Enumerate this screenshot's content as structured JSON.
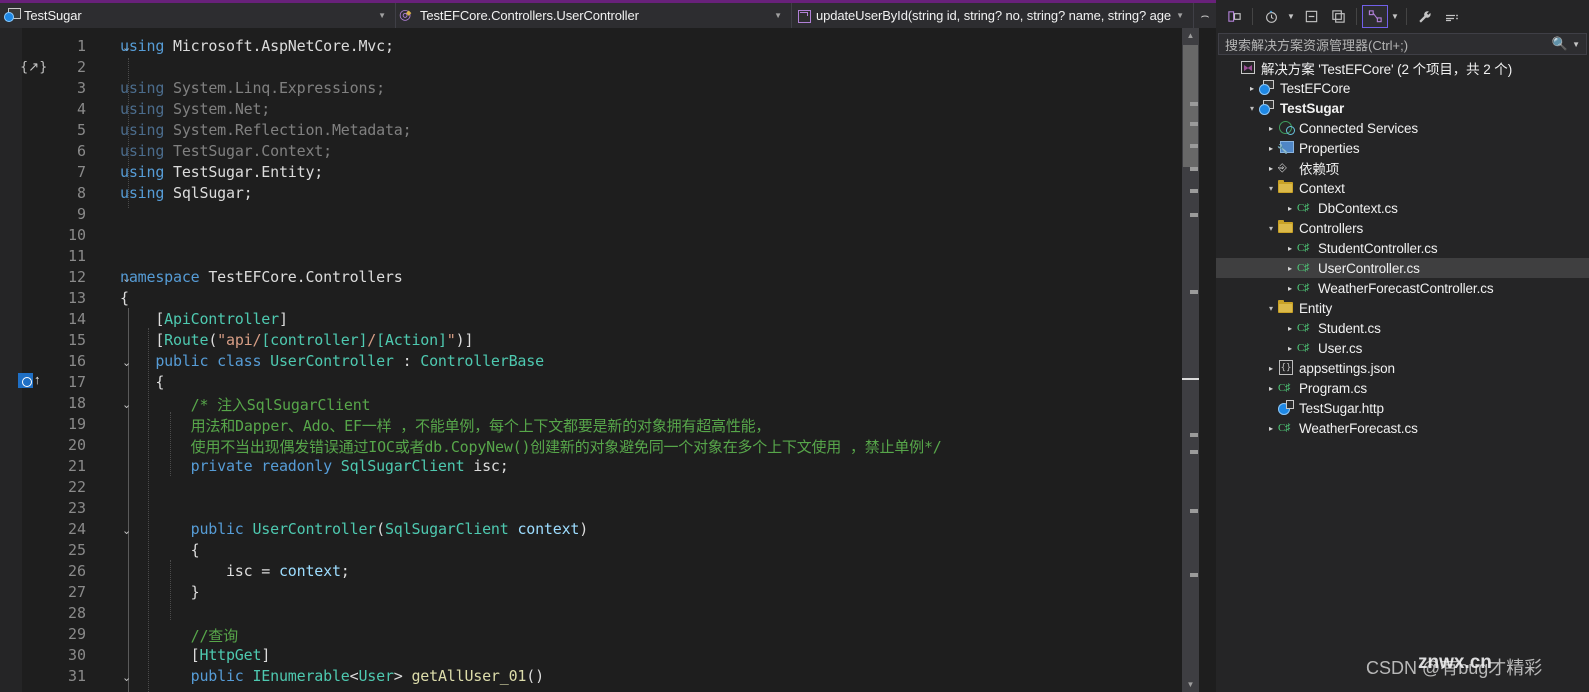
{
  "navbar": {
    "project": {
      "label": "TestSugar",
      "icon": "project-globe-icon"
    },
    "type": {
      "label": "TestEFCore.Controllers.UserController",
      "icon": "class-icon"
    },
    "member": {
      "label": "updateUserById(string id, string? no, string? name, string? age",
      "icon": "method-icon"
    },
    "split_icon": "split-window-icon"
  },
  "editor": {
    "glyph_codeaction": "{ }",
    "lines": [
      {
        "n": 1,
        "chev": "v",
        "segs": [
          {
            "t": "using ",
            "c": "k"
          },
          {
            "t": "Microsoft.AspNetCore.Mvc;",
            "c": "n"
          }
        ]
      },
      {
        "n": 2,
        "chev": "",
        "segs": []
      },
      {
        "n": 3,
        "chev": "",
        "segs": [
          {
            "t": "using ",
            "c": "kd"
          },
          {
            "t": "System.Linq.Expressions;",
            "c": "nd"
          }
        ]
      },
      {
        "n": 4,
        "chev": "",
        "segs": [
          {
            "t": "using ",
            "c": "kd"
          },
          {
            "t": "System.Net;",
            "c": "nd"
          }
        ]
      },
      {
        "n": 5,
        "chev": "",
        "segs": [
          {
            "t": "using ",
            "c": "kd"
          },
          {
            "t": "System.Reflection.Metadata;",
            "c": "nd"
          }
        ]
      },
      {
        "n": 6,
        "chev": "",
        "segs": [
          {
            "t": "using ",
            "c": "kd"
          },
          {
            "t": "TestSugar.Context;",
            "c": "nd"
          }
        ]
      },
      {
        "n": 7,
        "chev": "",
        "segs": [
          {
            "t": "using ",
            "c": "k"
          },
          {
            "t": "TestSugar.Entity;",
            "c": "n"
          }
        ]
      },
      {
        "n": 8,
        "chev": "",
        "segs": [
          {
            "t": "using ",
            "c": "k"
          },
          {
            "t": "SqlSugar;",
            "c": "n"
          }
        ]
      },
      {
        "n": 9,
        "chev": "",
        "segs": []
      },
      {
        "n": 10,
        "chev": "",
        "segs": []
      },
      {
        "n": 11,
        "chev": "",
        "segs": []
      },
      {
        "n": 12,
        "chev": "v",
        "segs": [
          {
            "t": "namespace ",
            "c": "k"
          },
          {
            "t": "TestEFCore.Controllers",
            "c": "n"
          }
        ]
      },
      {
        "n": 13,
        "chev": "",
        "segs": [
          {
            "t": "{",
            "c": "p"
          }
        ]
      },
      {
        "n": 14,
        "chev": "",
        "segs": [
          {
            "t": "    [",
            "c": "p"
          },
          {
            "t": "ApiController",
            "c": "at"
          },
          {
            "t": "]",
            "c": "p"
          }
        ]
      },
      {
        "n": 15,
        "chev": "",
        "segs": [
          {
            "t": "    [",
            "c": "p"
          },
          {
            "t": "Route",
            "c": "at"
          },
          {
            "t": "(",
            "c": "p"
          },
          {
            "t": "\"api/",
            "c": "s"
          },
          {
            "t": "[controller]",
            "c": "at"
          },
          {
            "t": "/",
            "c": "s"
          },
          {
            "t": "[Action]",
            "c": "at"
          },
          {
            "t": "\"",
            "c": "s"
          },
          {
            "t": ")]",
            "c": "p"
          }
        ]
      },
      {
        "n": 16,
        "chev": "v",
        "segs": [
          {
            "t": "    public class ",
            "c": "k"
          },
          {
            "t": "UserController",
            "c": "t"
          },
          {
            "t": " : ",
            "c": "p"
          },
          {
            "t": "ControllerBase",
            "c": "t"
          }
        ]
      },
      {
        "n": 17,
        "chev": "",
        "segs": [
          {
            "t": "    {",
            "c": "p"
          }
        ]
      },
      {
        "n": 18,
        "chev": "v",
        "segs": [
          {
            "t": "        /* 注入SqlSugarClient",
            "c": "c"
          }
        ]
      },
      {
        "n": 19,
        "chev": "",
        "segs": [
          {
            "t": "        用法和Dapper、Ado、EF一样 ，不能单例，每个上下文都要是新的对象拥有超高性能，",
            "c": "c"
          }
        ]
      },
      {
        "n": 20,
        "chev": "",
        "segs": [
          {
            "t": "        使用不当出现偶发错误通过IOC或者db.CopyNew()创建新的对象避免同一个对象在多个上下文使用 ，禁止单例*/",
            "c": "c"
          }
        ]
      },
      {
        "n": 21,
        "chev": "",
        "segs": [
          {
            "t": "        private readonly ",
            "c": "k"
          },
          {
            "t": "SqlSugarClient",
            "c": "t"
          },
          {
            "t": " isc;",
            "c": "n"
          }
        ]
      },
      {
        "n": 22,
        "chev": "",
        "segs": []
      },
      {
        "n": 23,
        "chev": "",
        "segs": []
      },
      {
        "n": 24,
        "chev": "v",
        "segs": [
          {
            "t": "        public ",
            "c": "k"
          },
          {
            "t": "UserController",
            "c": "t"
          },
          {
            "t": "(",
            "c": "p"
          },
          {
            "t": "SqlSugarClient",
            "c": "t"
          },
          {
            "t": " ",
            "c": "p"
          },
          {
            "t": "context",
            "c": "var"
          },
          {
            "t": ")",
            "c": "p"
          }
        ]
      },
      {
        "n": 25,
        "chev": "",
        "segs": [
          {
            "t": "        {",
            "c": "p"
          }
        ]
      },
      {
        "n": 26,
        "chev": "",
        "segs": [
          {
            "t": "            isc = ",
            "c": "n"
          },
          {
            "t": "context",
            "c": "var"
          },
          {
            "t": ";",
            "c": "n"
          }
        ]
      },
      {
        "n": 27,
        "chev": "",
        "segs": [
          {
            "t": "        }",
            "c": "p"
          }
        ]
      },
      {
        "n": 28,
        "chev": "",
        "segs": []
      },
      {
        "n": 29,
        "chev": "",
        "segs": [
          {
            "t": "        //查询",
            "c": "c"
          }
        ]
      },
      {
        "n": 30,
        "chev": "",
        "segs": [
          {
            "t": "        [",
            "c": "p"
          },
          {
            "t": "HttpGet",
            "c": "at"
          },
          {
            "t": "]",
            "c": "p"
          }
        ]
      },
      {
        "n": 31,
        "chev": "v",
        "segs": [
          {
            "t": "        public ",
            "c": "k"
          },
          {
            "t": "IEnumerable",
            "c": "t"
          },
          {
            "t": "<",
            "c": "p"
          },
          {
            "t": "User",
            "c": "t"
          },
          {
            "t": "> ",
            "c": "p"
          },
          {
            "t": "getAllUser_01",
            "c": "m"
          },
          {
            "t": "()",
            "c": "p"
          }
        ]
      }
    ],
    "inherit_glyph": "inheritance-up-icon"
  },
  "solution_explorer": {
    "toolbar_buttons": [
      {
        "name": "collapse-to-definitions-icon",
        "glyph": "⇲"
      },
      {
        "name": "pending-changes-filter-icon",
        "glyph": "◴"
      },
      {
        "name": "filter-dropdown-icon",
        "glyph": "▾"
      },
      {
        "name": "collapse-all-icon",
        "glyph": "⊟"
      },
      {
        "name": "show-all-files-icon",
        "glyph": "⧉"
      },
      {
        "name": "sync-with-active-document-icon",
        "glyph": "⤢"
      },
      {
        "name": "view-dropdown-icon",
        "glyph": "▾"
      },
      {
        "name": "properties-icon",
        "glyph": "🔧"
      },
      {
        "name": "preview-selected-items-icon",
        "glyph": "≔"
      }
    ],
    "search_placeholder": "搜索解决方案资源管理器(Ctrl+;)",
    "search_value": "",
    "tree": [
      {
        "depth": 0,
        "expander": "none",
        "icon": "solution-icon",
        "label": "解决方案 'TestEFCore' (2 个项目，共 2 个)",
        "bold": false,
        "selected": false
      },
      {
        "depth": 1,
        "expander": "collapsed",
        "icon": "project-icon",
        "label": "TestEFCore",
        "bold": false,
        "selected": false
      },
      {
        "depth": 1,
        "expander": "expanded",
        "icon": "project-icon",
        "label": "TestSugar",
        "bold": true,
        "selected": false
      },
      {
        "depth": 2,
        "expander": "collapsed",
        "icon": "connected-services-icon",
        "label": "Connected Services",
        "bold": false,
        "selected": false
      },
      {
        "depth": 2,
        "expander": "collapsed",
        "icon": "properties-folder-icon",
        "label": "Properties",
        "bold": false,
        "selected": false
      },
      {
        "depth": 2,
        "expander": "collapsed",
        "icon": "dependencies-icon",
        "label": "依赖项",
        "bold": false,
        "selected": false
      },
      {
        "depth": 2,
        "expander": "expanded",
        "icon": "folder-icon",
        "label": "Context",
        "bold": false,
        "selected": false
      },
      {
        "depth": 3,
        "expander": "collapsed",
        "icon": "csharp-file-icon",
        "label": "DbContext.cs",
        "bold": false,
        "selected": false
      },
      {
        "depth": 2,
        "expander": "expanded",
        "icon": "folder-icon",
        "label": "Controllers",
        "bold": false,
        "selected": false
      },
      {
        "depth": 3,
        "expander": "collapsed",
        "icon": "csharp-file-icon",
        "label": "StudentController.cs",
        "bold": false,
        "selected": false
      },
      {
        "depth": 3,
        "expander": "collapsed",
        "icon": "csharp-file-icon",
        "label": "UserController.cs",
        "bold": false,
        "selected": true
      },
      {
        "depth": 3,
        "expander": "collapsed",
        "icon": "csharp-file-icon",
        "label": "WeatherForecastController.cs",
        "bold": false,
        "selected": false
      },
      {
        "depth": 2,
        "expander": "expanded",
        "icon": "folder-icon",
        "label": "Entity",
        "bold": false,
        "selected": false
      },
      {
        "depth": 3,
        "expander": "collapsed",
        "icon": "csharp-file-icon",
        "label": "Student.cs",
        "bold": false,
        "selected": false
      },
      {
        "depth": 3,
        "expander": "collapsed",
        "icon": "csharp-file-icon",
        "label": "User.cs",
        "bold": false,
        "selected": false
      },
      {
        "depth": 2,
        "expander": "collapsed",
        "icon": "json-file-icon",
        "label": "appsettings.json",
        "bold": false,
        "selected": false
      },
      {
        "depth": 2,
        "expander": "collapsed",
        "icon": "csharp-file-icon",
        "label": "Program.cs",
        "bold": false,
        "selected": false
      },
      {
        "depth": 2,
        "expander": "none",
        "icon": "http-file-icon",
        "label": "TestSugar.http",
        "bold": false,
        "selected": false
      },
      {
        "depth": 2,
        "expander": "collapsed",
        "icon": "csharp-file-icon",
        "label": "WeatherForecast.cs",
        "bold": false,
        "selected": false
      }
    ]
  },
  "annotation": {
    "shape": "red-ellipse",
    "color": "#e02020",
    "target": "UserController.cs"
  },
  "watermark": {
    "line1": "CSDN @有bug才精彩",
    "line2": "znwx.cn"
  },
  "colors": {
    "accent": "#68217a",
    "editor_bg": "#1e1e1e",
    "panel_bg": "#252526",
    "selection": "#3f3f40",
    "annotation_red": "#e02020"
  }
}
